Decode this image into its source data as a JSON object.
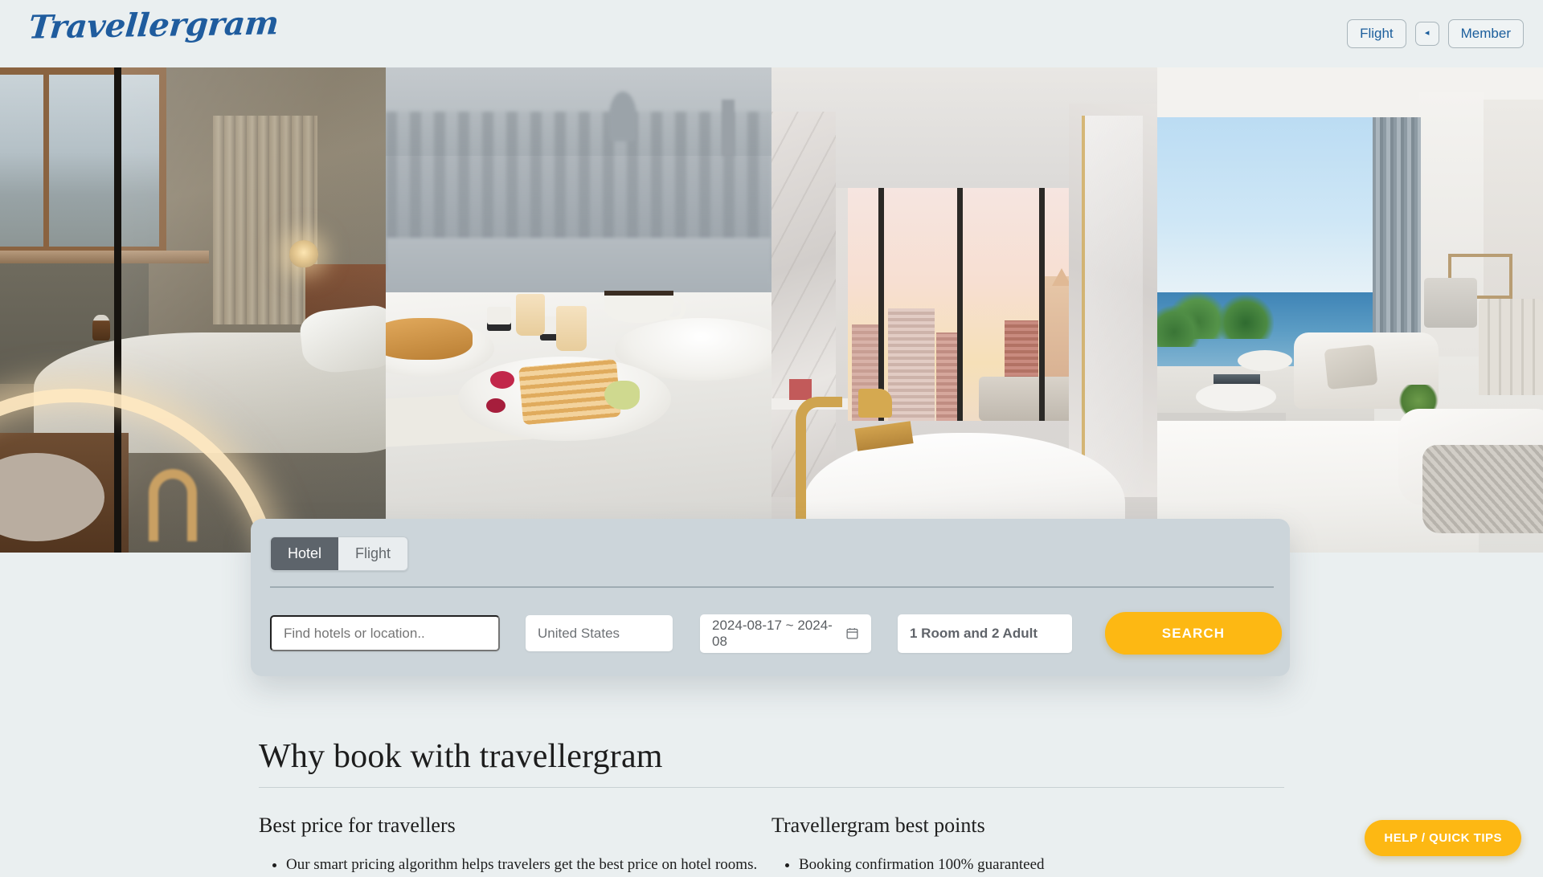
{
  "header": {
    "logo_text": "Travellergram",
    "logo_color": "#1f5c9e",
    "buttons": [
      {
        "label": "Flight",
        "name": "flight-button"
      },
      {
        "label": "◂",
        "name": "collapse-button"
      },
      {
        "label": "Member",
        "name": "member-button"
      }
    ]
  },
  "hero": {
    "images": [
      {
        "alt": "Hotel room with bed and window view and circular ring light"
      },
      {
        "alt": "Breakfast in bed with waffles croissant and coffee overlooking the city"
      },
      {
        "alt": "Marble bathroom with freestanding tub and city skyline at sunset"
      },
      {
        "alt": "Ocean view suite with white sofa palm trees and sea"
      }
    ]
  },
  "search": {
    "tabs": [
      {
        "label": "Hotel",
        "active": true
      },
      {
        "label": "Flight",
        "active": false
      }
    ],
    "destination_placeholder": "Find hotels or location..",
    "destination_value": "",
    "country_value": "United States",
    "dates_value": "2024-08-17 ~ 2024-08",
    "rooms_value": "1 Room and 2 Adult",
    "search_button_label": "SEARCH",
    "accent_color": "#fdb813",
    "panel_color": "#ccd5da",
    "calendar_icon": "calendar-icon"
  },
  "why_section": {
    "title": "Why book with travellergram",
    "columns": [
      {
        "heading": "Best price for travellers",
        "items": [
          "Our smart pricing algorithm helps travelers get the best price on hotel rooms."
        ]
      },
      {
        "heading": "Travellergram best points",
        "items": [
          "Booking confirmation 100% guaranteed"
        ]
      }
    ]
  },
  "help_fab": {
    "label": "HELP / QUICK TIPS",
    "color": "#fdb813"
  }
}
